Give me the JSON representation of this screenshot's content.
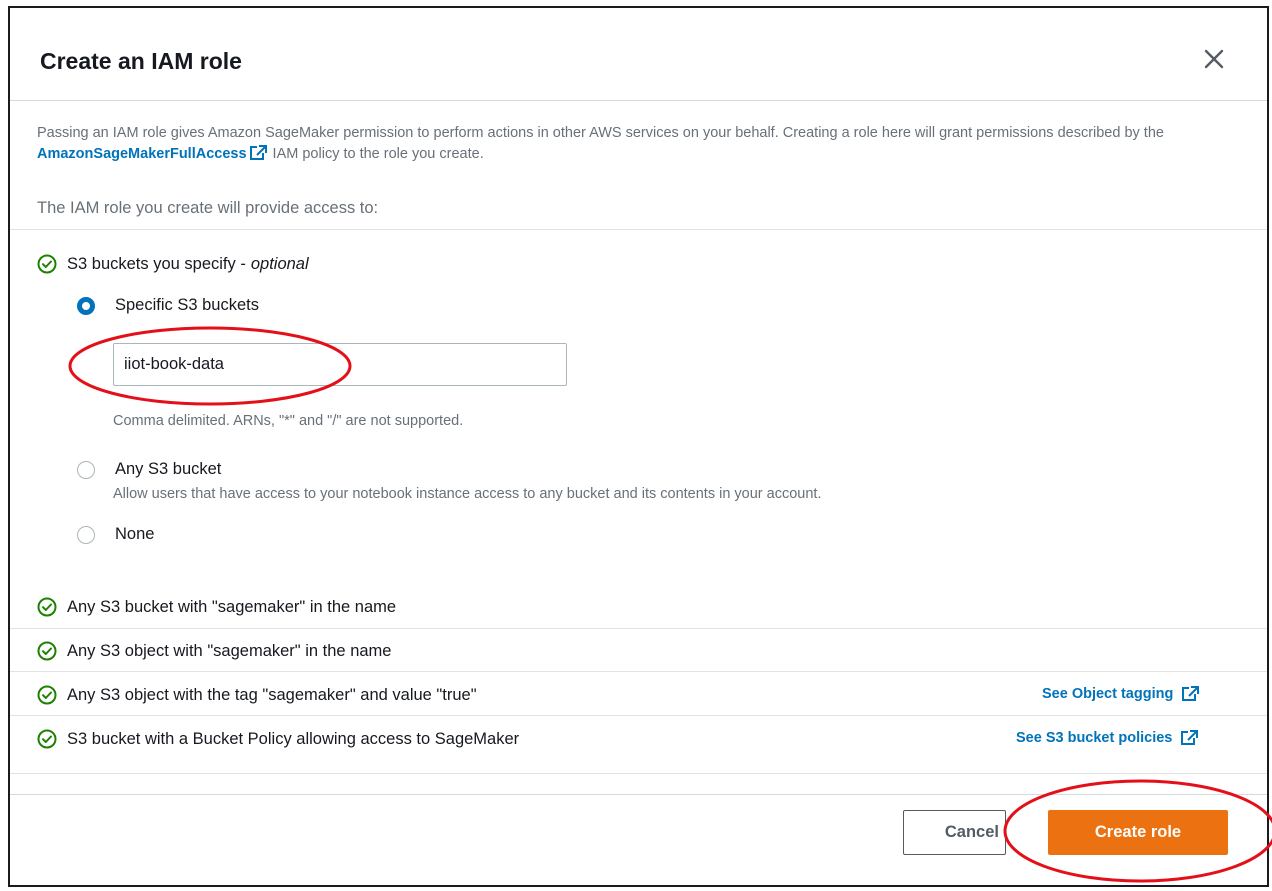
{
  "modal": {
    "title": "Create an IAM role",
    "close_label": "Close"
  },
  "description": {
    "before_link": "Passing an IAM role gives Amazon SageMaker permission to perform actions in other AWS services on your behalf. Creating a role here will grant permissions described by the ",
    "link": "AmazonSageMakerFullAccess",
    "after_link": " IAM policy to the role you create."
  },
  "subheading": "The IAM role you create will provide access to:",
  "s3_section": {
    "label": "S3 buckets you specify - ",
    "label_optional": "optional",
    "options": [
      {
        "label": "Specific S3 buckets",
        "selected": true
      },
      {
        "label": "Any S3 bucket",
        "selected": false,
        "description": "Allow users that have access to your notebook instance access to any bucket and its contents in your account."
      },
      {
        "label": "None",
        "selected": false
      }
    ],
    "bucket_input_value": "iiot-book-data",
    "hint": "Comma delimited. ARNs, \"*\" and \"/\" are not supported."
  },
  "access_items": [
    {
      "label": "Any S3 bucket with \"sagemaker\" in the name"
    },
    {
      "label": "Any S3 object with \"sagemaker\" in the name"
    },
    {
      "label": "Any S3 object with the tag \"sagemaker\" and value \"true\"",
      "link": "See Object tagging"
    },
    {
      "label": "S3 bucket with a Bucket Policy allowing access to SageMaker",
      "link": "See S3 bucket policies"
    }
  ],
  "footer": {
    "cancel_label": "Cancel",
    "create_label": "Create role"
  },
  "colors": {
    "link": "#0073bb",
    "primary_button": "#ec7211",
    "success_check": "#1d8102",
    "annotation": "#e3101a"
  }
}
